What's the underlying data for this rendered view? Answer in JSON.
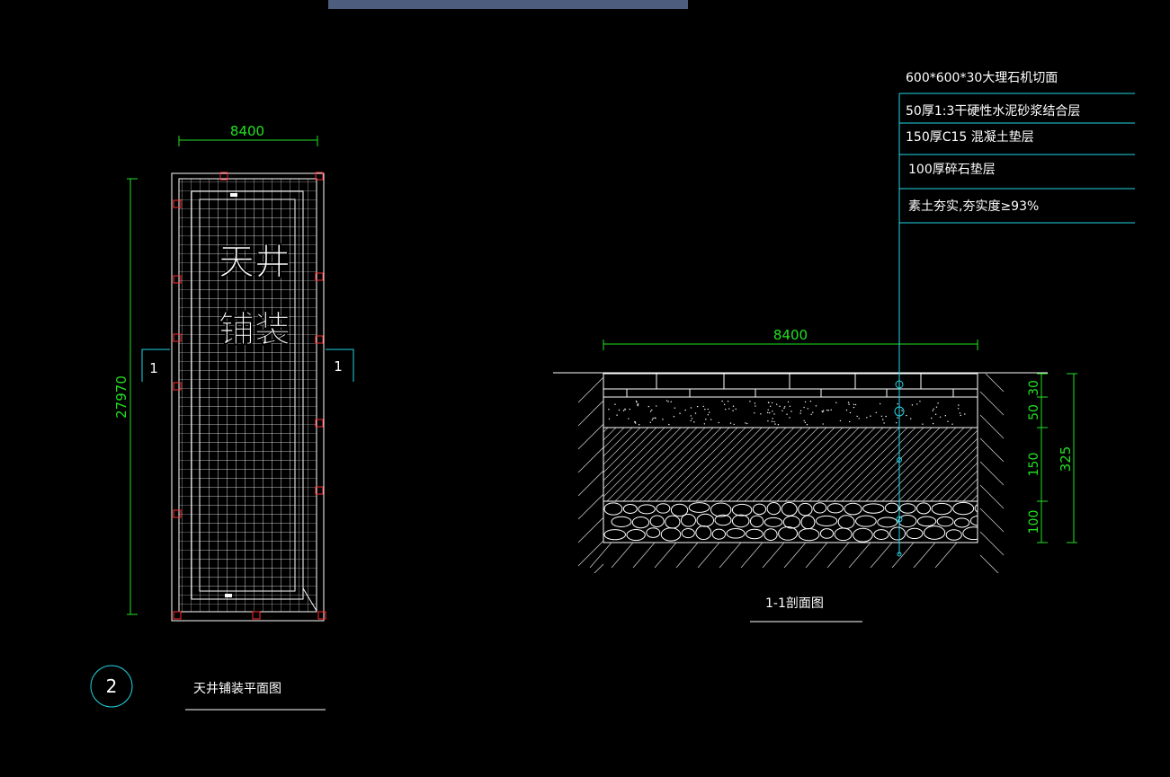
{
  "plan": {
    "width_dim": "8400",
    "height_dim": "27970",
    "room_label_line1": "天井",
    "room_label_line2": "铺装",
    "section_mark_left": "1",
    "section_mark_right": "1",
    "drawing_number": "2",
    "title": "天井铺装平面图"
  },
  "section": {
    "width_dim": "8400",
    "title": "1-1剖面图",
    "layer_dims": [
      "30",
      "50",
      "150",
      "100"
    ],
    "total_dim": "325",
    "layers": [
      "600*600*30大理石机切面",
      "50厚1:3干硬性水泥砂浆结合层",
      "150厚C15 混凝土垫层",
      "100厚碎石垫层",
      "素土夯实,夯实度≥93%"
    ]
  },
  "colors": {
    "background": "#000000",
    "linework": "#ffffff",
    "dimension": "#22e022",
    "leader": "#22d6e6",
    "column": "#ff2a2a",
    "hatch": "#c8c8c8",
    "topbar": "#4d5d7e"
  }
}
